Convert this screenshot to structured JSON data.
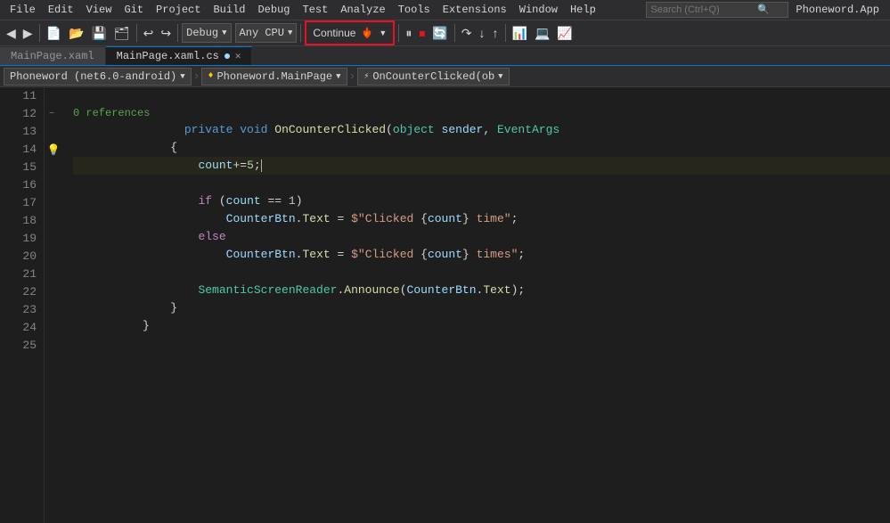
{
  "menubar": {
    "items": [
      "File",
      "Edit",
      "View",
      "Git",
      "Project",
      "Build",
      "Debug",
      "Test",
      "Analyze",
      "Tools",
      "Extensions",
      "Window",
      "Help"
    ],
    "search_placeholder": "Search (Ctrl+Q)",
    "app_name": "Phoneword.App"
  },
  "toolbar": {
    "debug_label": "Debug",
    "cpu_label": "Any CPU",
    "continue_label": "Continue",
    "icons": [
      "↩",
      "↪",
      "↰",
      "↱"
    ]
  },
  "tabs": [
    {
      "id": "xaml",
      "label": "MainPage.xaml",
      "active": false,
      "modified": false,
      "closable": false
    },
    {
      "id": "cs",
      "label": "MainPage.xaml.cs",
      "active": true,
      "modified": true,
      "closable": true
    }
  ],
  "navbar": {
    "project": "Phoneword (net6.0-android)",
    "class": "Phoneword.MainPage",
    "member": "OnCounterClicked(ob"
  },
  "code": {
    "ref_label": "0 references",
    "lines": [
      {
        "num": 11,
        "content": ""
      },
      {
        "num": 12,
        "content": "        private void OnCounterClicked(object sender, EventArgs",
        "has_collapse": true
      },
      {
        "num": 13,
        "content": "        {"
      },
      {
        "num": 14,
        "content": "            count+=5;",
        "is_cursor": true,
        "has_lightbulb": true
      },
      {
        "num": 15,
        "content": ""
      },
      {
        "num": 16,
        "content": "            if (count == 1)"
      },
      {
        "num": 17,
        "content": "                CounterBtn.Text = $\"Clicked {count} time\";"
      },
      {
        "num": 18,
        "content": "            else"
      },
      {
        "num": 19,
        "content": "                CounterBtn.Text = $\"Clicked {count} times\";"
      },
      {
        "num": 20,
        "content": ""
      },
      {
        "num": 21,
        "content": "            SemanticScreenReader.Announce(CounterBtn.Text);"
      },
      {
        "num": 22,
        "content": "        }"
      },
      {
        "num": 23,
        "content": "    }"
      },
      {
        "num": 24,
        "content": ""
      },
      {
        "num": 25,
        "content": ""
      }
    ]
  },
  "colors": {
    "accent": "#007acc",
    "red_border": "#e81123",
    "active_tab_top": "#007acc"
  }
}
